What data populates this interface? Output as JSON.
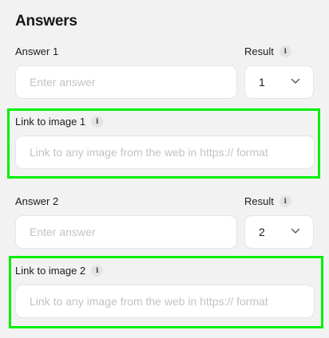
{
  "section": {
    "title": "Answers"
  },
  "answers": [
    {
      "answer_label": "Answer 1",
      "answer_placeholder": "Enter answer",
      "result_label": "Result",
      "result_value": "1",
      "image_label": "Link to image 1",
      "image_placeholder": "Link to any image from the web in https:// format"
    },
    {
      "answer_label": "Answer 2",
      "answer_placeholder": "Enter answer",
      "result_label": "Result",
      "result_value": "2",
      "image_label": "Link to image 2",
      "image_placeholder": "Link to any image from the web in https:// format"
    }
  ],
  "icons": {
    "info": "i",
    "info_name": "info-icon",
    "dropdown_name": "chevron-down-icon"
  },
  "colors": {
    "background": "#f2f2f3",
    "highlight": "#00f000",
    "input_border": "#e5e5e7",
    "placeholder": "#c3c3c6"
  }
}
